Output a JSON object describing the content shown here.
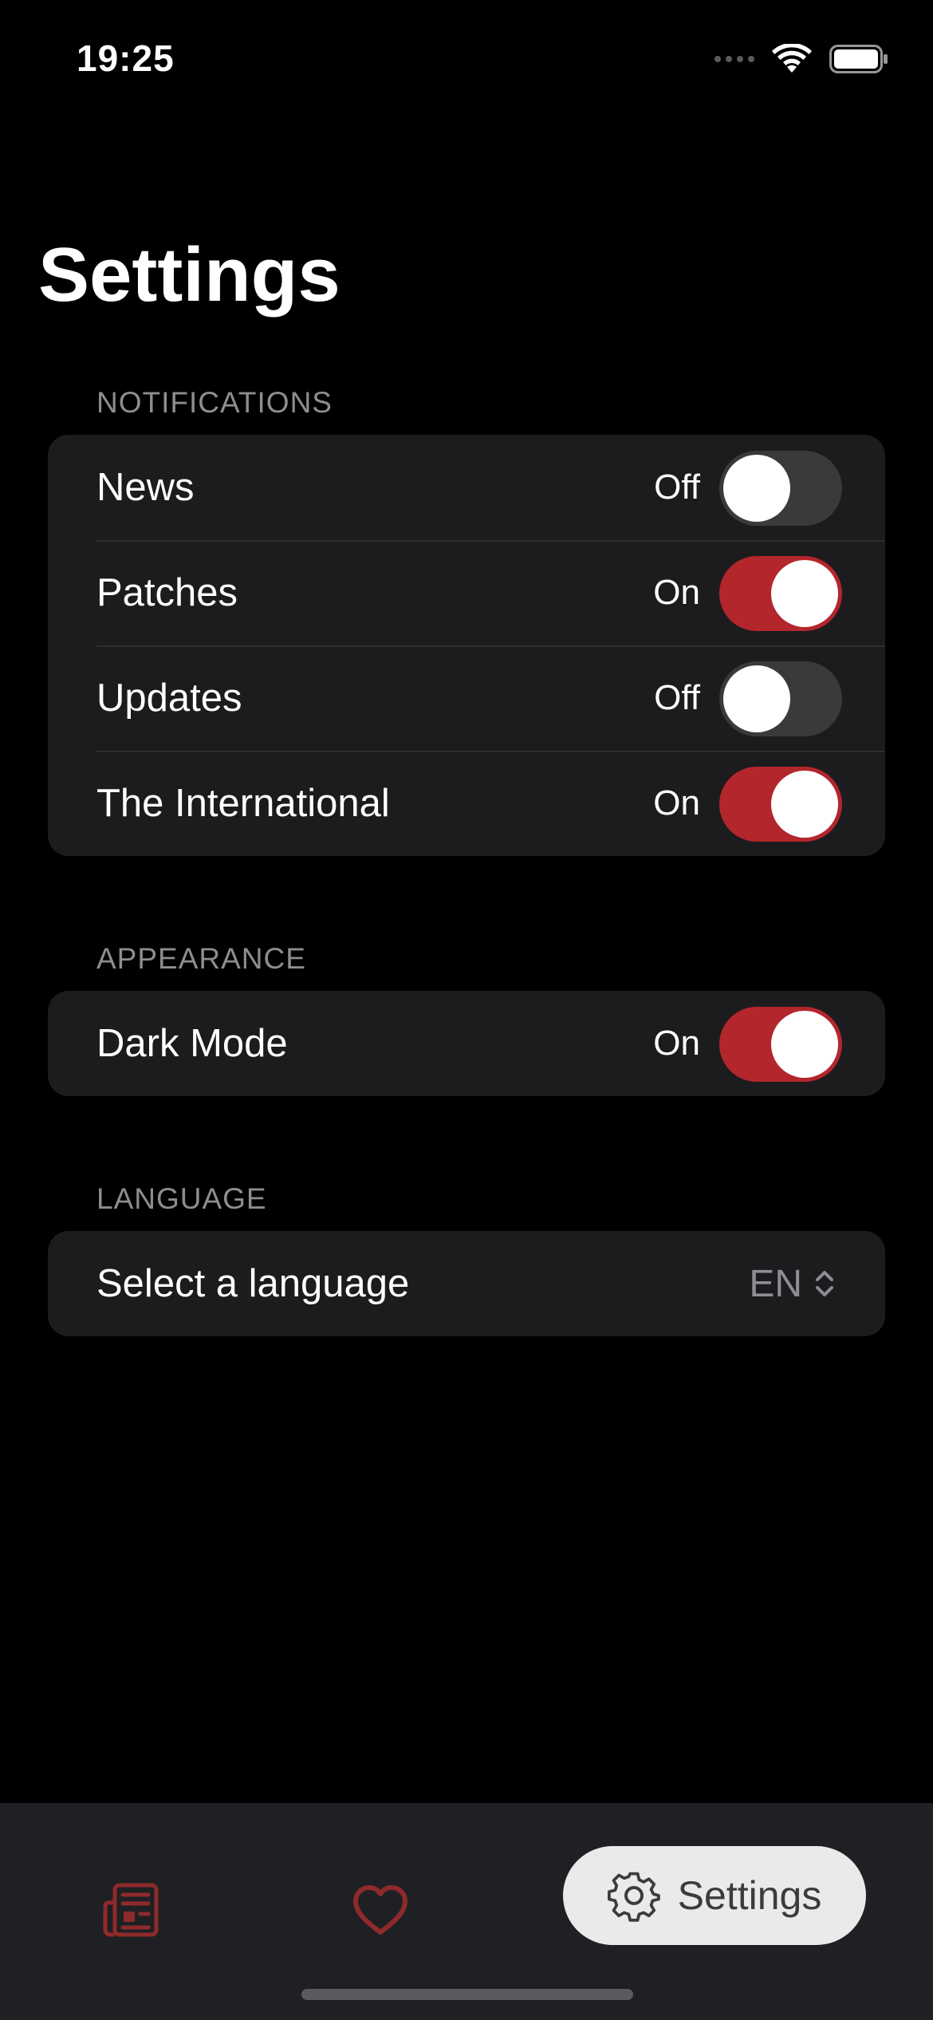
{
  "status_bar": {
    "time": "19:25",
    "icons": [
      "cellular-signal-icon",
      "wifi-icon",
      "battery-icon"
    ]
  },
  "page": {
    "title": "Settings"
  },
  "sections": {
    "notifications": {
      "header": "NOTIFICATIONS",
      "rows": [
        {
          "label": "News",
          "state": "Off",
          "on": false
        },
        {
          "label": "Patches",
          "state": "On",
          "on": true
        },
        {
          "label": "Updates",
          "state": "Off",
          "on": false
        },
        {
          "label": "The International",
          "state": "On",
          "on": true
        }
      ]
    },
    "appearance": {
      "header": "APPEARANCE",
      "rows": [
        {
          "label": "Dark Mode",
          "state": "On",
          "on": true
        }
      ]
    },
    "language": {
      "header": "LANGUAGE",
      "label": "Select a language",
      "value": "EN",
      "icon": "chevron-up-down-icon"
    }
  },
  "tab_bar": {
    "tabs": [
      {
        "icon": "newspaper-icon",
        "selected": false
      },
      {
        "icon": "heart-icon",
        "selected": false
      },
      {
        "icon": "gear-icon",
        "label": "Settings",
        "selected": true
      }
    ]
  },
  "colors": {
    "accent": "#b3262c",
    "background": "#000000",
    "group_background": "#1c1c1e",
    "toggle_off": "#3a3a3d",
    "secondary_text": "#8d8d92",
    "tab_bar": "#1f2023",
    "selected_tab_pill": "#e9ebea"
  }
}
